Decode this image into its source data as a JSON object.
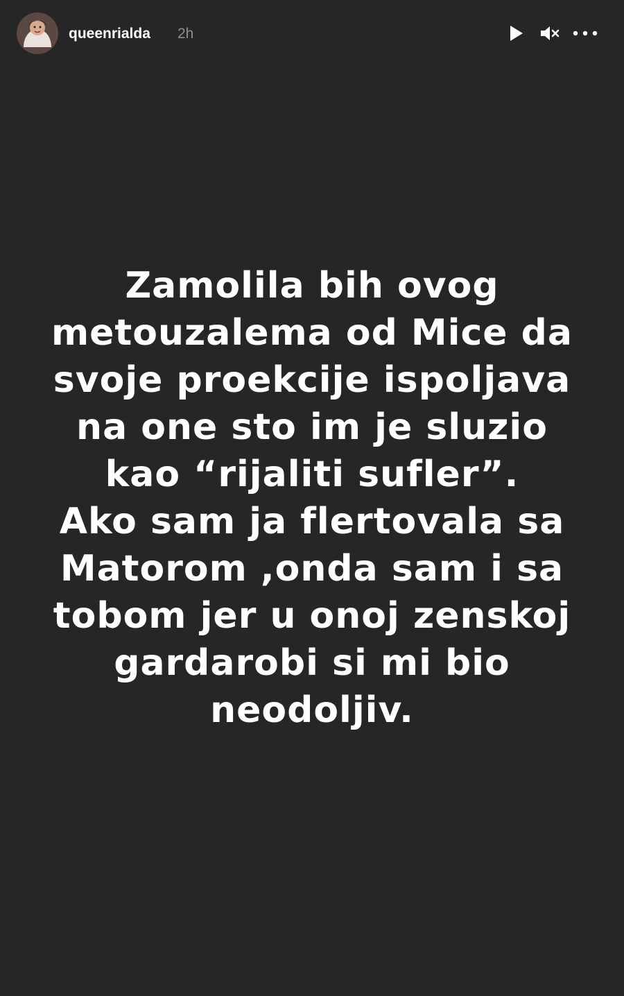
{
  "header": {
    "username": "queenrialda",
    "time_ago": "2h"
  },
  "controls": {
    "play_icon": "play-icon",
    "mute_icon": "speaker-muted-icon",
    "more_icon": "more-options-icon"
  },
  "story": {
    "lines": [
      "Zamolila bih ovog",
      "metouzalema od Mice da",
      "svoje proekcije ispoljava",
      "na one sto im je sluzio",
      "kao “rijaliti sufler”.",
      "Ako sam ja flertovala sa",
      "Matorom ,onda sam i sa",
      "tobom jer u onoj zenskoj",
      "gardarobi si mi bio",
      "neodoljiv."
    ]
  },
  "colors": {
    "background": "#262626",
    "text": "#ffffff",
    "muted_text": "#8e8e8e"
  }
}
